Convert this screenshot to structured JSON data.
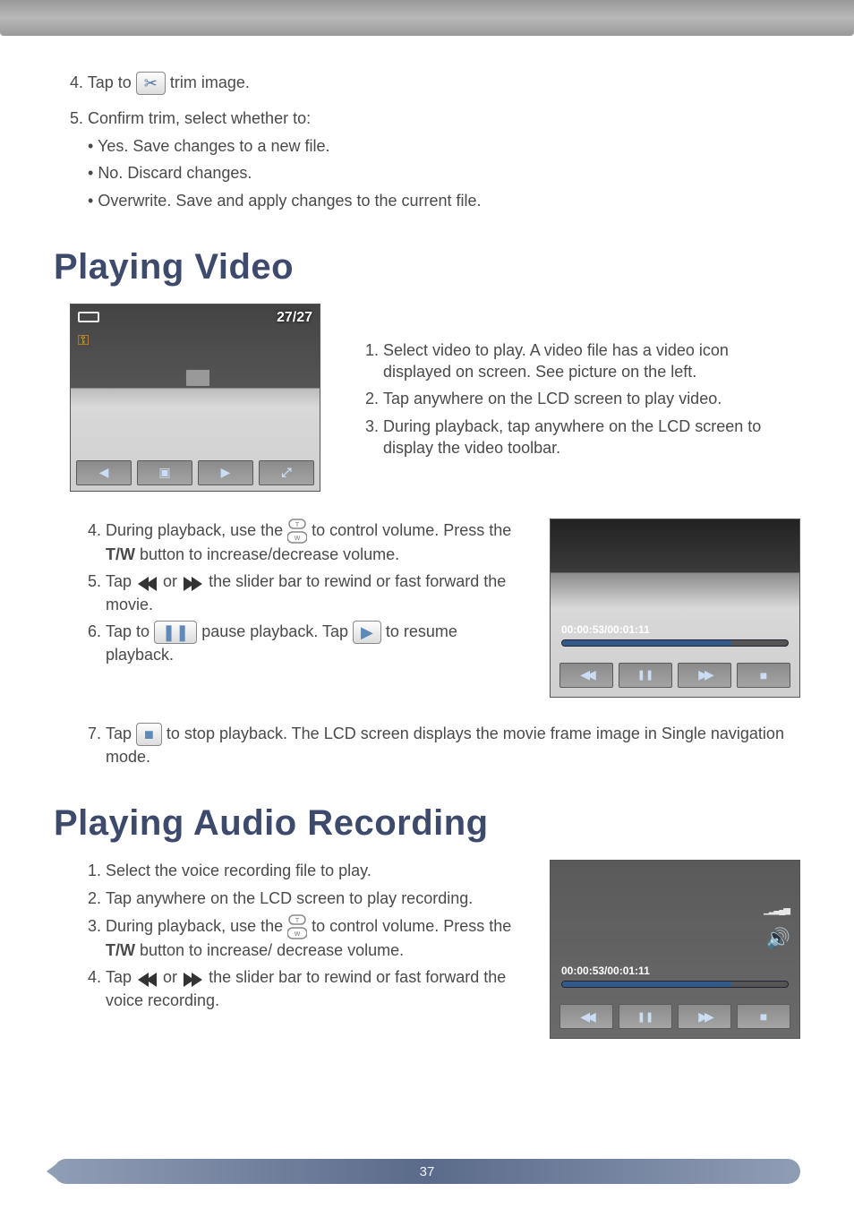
{
  "top": {
    "step4_a": "4. Tap to ",
    "step4_b": " trim image.",
    "step5": "5. Confirm trim, select whether to:",
    "bullets": {
      "b1": "Yes. Save changes to a new file.",
      "b2": "No. Discard changes.",
      "b3": " Overwrite. Save and apply changes to the current file."
    }
  },
  "video": {
    "heading": "Playing Video",
    "lcd_counter": "27/27",
    "steps": {
      "s1": "Select video to play. A video file has a video icon displayed on screen. See picture on the left.",
      "s2": "Tap anywhere on the LCD screen to play video.",
      "s3": "During playback, tap anywhere on the LCD screen to display the video toolbar.",
      "s4_a": "During playback, use the ",
      "s4_b": " to control volume. Press the ",
      "s4_c": " button to increase/decrease volume.",
      "s5_a": "Tap ",
      "s5_b": " or ",
      "s5_c": " the slider bar to rewind or fast forward the movie.",
      "s6_a": "Tap to ",
      "s6_b": " pause playback. Tap ",
      "s6_c": " to resume playback.",
      "s7_a": "Tap ",
      "s7_b": " to stop playback. The LCD screen displays the movie frame image in Single navigation mode."
    },
    "tw_label": "T/W",
    "timecode": "00:00:53/00:01:11"
  },
  "audio": {
    "heading": "Playing Audio Recording",
    "steps": {
      "s1": "Select the voice recording file to play.",
      "s2": "Tap anywhere on the LCD screen to play recording.",
      "s3_a": "During playback, use the ",
      "s3_b": " to control volume. Press the ",
      "s3_c": " button to increase/ decrease volume.",
      "s4_a": "Tap ",
      "s4_b": " or ",
      "s4_c": " the slider bar to rewind or fast forward the voice recording."
    },
    "tw_label": "T/W",
    "timecode": "00:00:53/00:01:11"
  },
  "page_number": "37"
}
